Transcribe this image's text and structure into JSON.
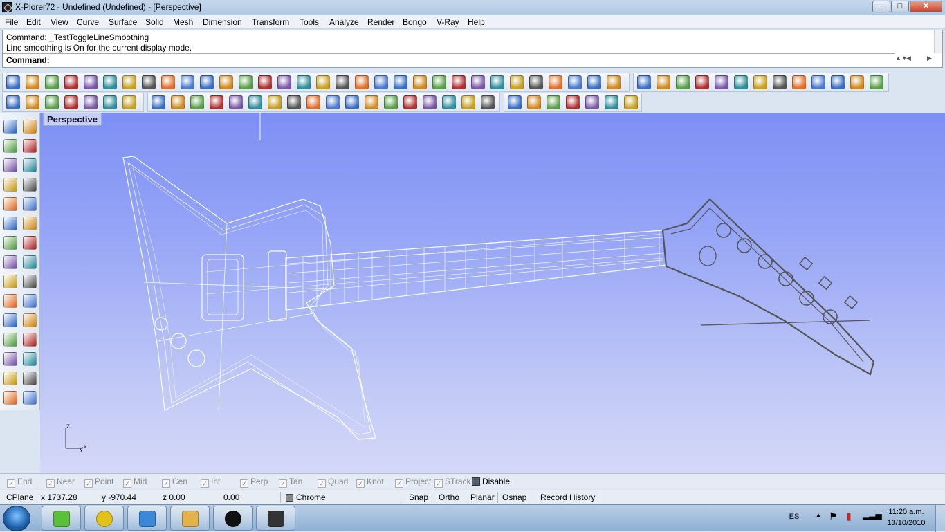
{
  "window": {
    "title": "X-Plorer72 - Undefined (Undefined) - [Perspective]",
    "controls": {
      "minimize": "─",
      "maximize": "□",
      "close": "✕"
    }
  },
  "menu": [
    "File",
    "Edit",
    "View",
    "Curve",
    "Surface",
    "Solid",
    "Mesh",
    "Dimension",
    "Transform",
    "Tools",
    "Analyze",
    "Render",
    "Bongo",
    "V-Ray",
    "Help"
  ],
  "command": {
    "history1": "Command: _TestToggleLineSmoothing",
    "history2": "Line smoothing is On for the current display mode.",
    "prompt": "Command:"
  },
  "toolbar_icons": {
    "row1_left": [
      "new-file-icon",
      "open-file-icon",
      "save-icon",
      "print-icon",
      "import-icon",
      "cut-icon",
      "copy-icon",
      "paste-icon",
      "undo-icon",
      "pan-icon",
      "rotate-view-icon",
      "zoom-dynamic-icon",
      "zoom-window-icon",
      "zoom-extents-icon",
      "zoom-selected-icon",
      "undo-view-icon",
      "four-viewports-icon",
      "car-icon",
      "texture-icon",
      "select-points-icon",
      "grid-icon",
      "light-icon",
      "lock-icon",
      "layer-icon",
      "color-wheel-icon",
      "wireframe-icon",
      "render-mesh-icon",
      "render-sphere-icon",
      "flag-icon",
      "options-gear-icon",
      "properties-icon",
      "help-icon"
    ],
    "row1_right": [
      "refresh-icon",
      "transform-icon",
      "settings-icon",
      "align-icon",
      "plane-icon",
      "edit-icon",
      "sphere-icon",
      "dimension-icon",
      "fold-icon",
      "puzzle-icon",
      "play-icon",
      "window-icon",
      "help-icon"
    ],
    "row2_left": [
      "snap-end-icon",
      "snap-near-icon",
      "snap-mid-icon",
      "snap-cube-icon",
      "snap-star-icon",
      "snap-tag-icon",
      "snap-check-icon"
    ],
    "row2_mid": [
      "arrow-double-icon",
      "diamond-icon",
      "sun-icon",
      "circle-icon",
      "box-icon",
      "chain-icon",
      "drop-icon",
      "list-icon",
      "clock-icon",
      "document-icon",
      "hourglass-icon",
      "angle-icon",
      "plus-box-icon",
      "recycle-icon",
      "camera-icon",
      "circle-outline-icon",
      "line-icon",
      "triangle-icon"
    ],
    "row2_right": [
      "stopwatch-icon",
      "tree-icon",
      "clapper-icon",
      "snake-icon",
      "video-camera-icon",
      "rainbow-icon",
      "help-icon"
    ]
  },
  "left_tools": [
    [
      "select-arrow-icon",
      "point-icon"
    ],
    [
      "polyline-icon",
      "curve-icon"
    ],
    [
      "circle-tool-icon",
      "ellipse-icon"
    ],
    [
      "arc-icon",
      "rectangle-icon"
    ],
    [
      "polygon-icon",
      "fillet-icon"
    ],
    [
      "surface-icon",
      "loft-icon"
    ],
    [
      "box-solid-icon",
      "sphere-solid-icon"
    ],
    [
      "cylinder-icon",
      "mesh-icon"
    ],
    [
      "gear-tool-icon",
      "boolean-icon"
    ],
    [
      "trim-icon",
      "split-icon"
    ],
    [
      "join-icon",
      "explode-icon"
    ],
    [
      "offset-icon",
      "extend-icon"
    ],
    [
      "text-icon",
      "scale-icon"
    ],
    [
      "array-icon",
      "mirror-icon"
    ],
    [
      "solid-cube-icon",
      "dimension-tool-icon"
    ]
  ],
  "viewport": {
    "label": "Perspective",
    "axis_z": "z",
    "axis_y": "y",
    "axis_x": "x"
  },
  "osnaps": [
    {
      "label": "End",
      "on": false
    },
    {
      "label": "Near",
      "on": false
    },
    {
      "label": "Point",
      "on": false
    },
    {
      "label": "Mid",
      "on": false
    },
    {
      "label": "Cen",
      "on": false
    },
    {
      "label": "Int",
      "on": false
    },
    {
      "label": "Perp",
      "on": false
    },
    {
      "label": "Tan",
      "on": false
    },
    {
      "label": "Quad",
      "on": false
    },
    {
      "label": "Knot",
      "on": false
    },
    {
      "label": "Project",
      "on": false
    },
    {
      "label": "STrack",
      "on": false
    },
    {
      "label": "Disable",
      "on": true
    }
  ],
  "status": {
    "cplane": "CPlane",
    "x": "x 1737.28",
    "y": "y -970.44",
    "z": "z 0.00",
    "extra": "0.00",
    "layer": "Chrome",
    "snap": "Snap",
    "ortho": "Ortho",
    "planar": "Planar",
    "osnap": "Osnap",
    "record": "Record History"
  },
  "taskbar": {
    "apps": [
      "users-app-icon",
      "chrome-icon",
      "media-player-icon",
      "explorer-folder-icon",
      "hp-icon",
      "rhino-app-icon"
    ],
    "lang": "ES",
    "time": "11:20 a.m.",
    "date": "13/10/2010"
  },
  "colors": {
    "viewport_top": "#7d8ff4",
    "viewport_bottom": "#d4d8f8",
    "wire": "#ffffff",
    "headstock": "#555555"
  }
}
